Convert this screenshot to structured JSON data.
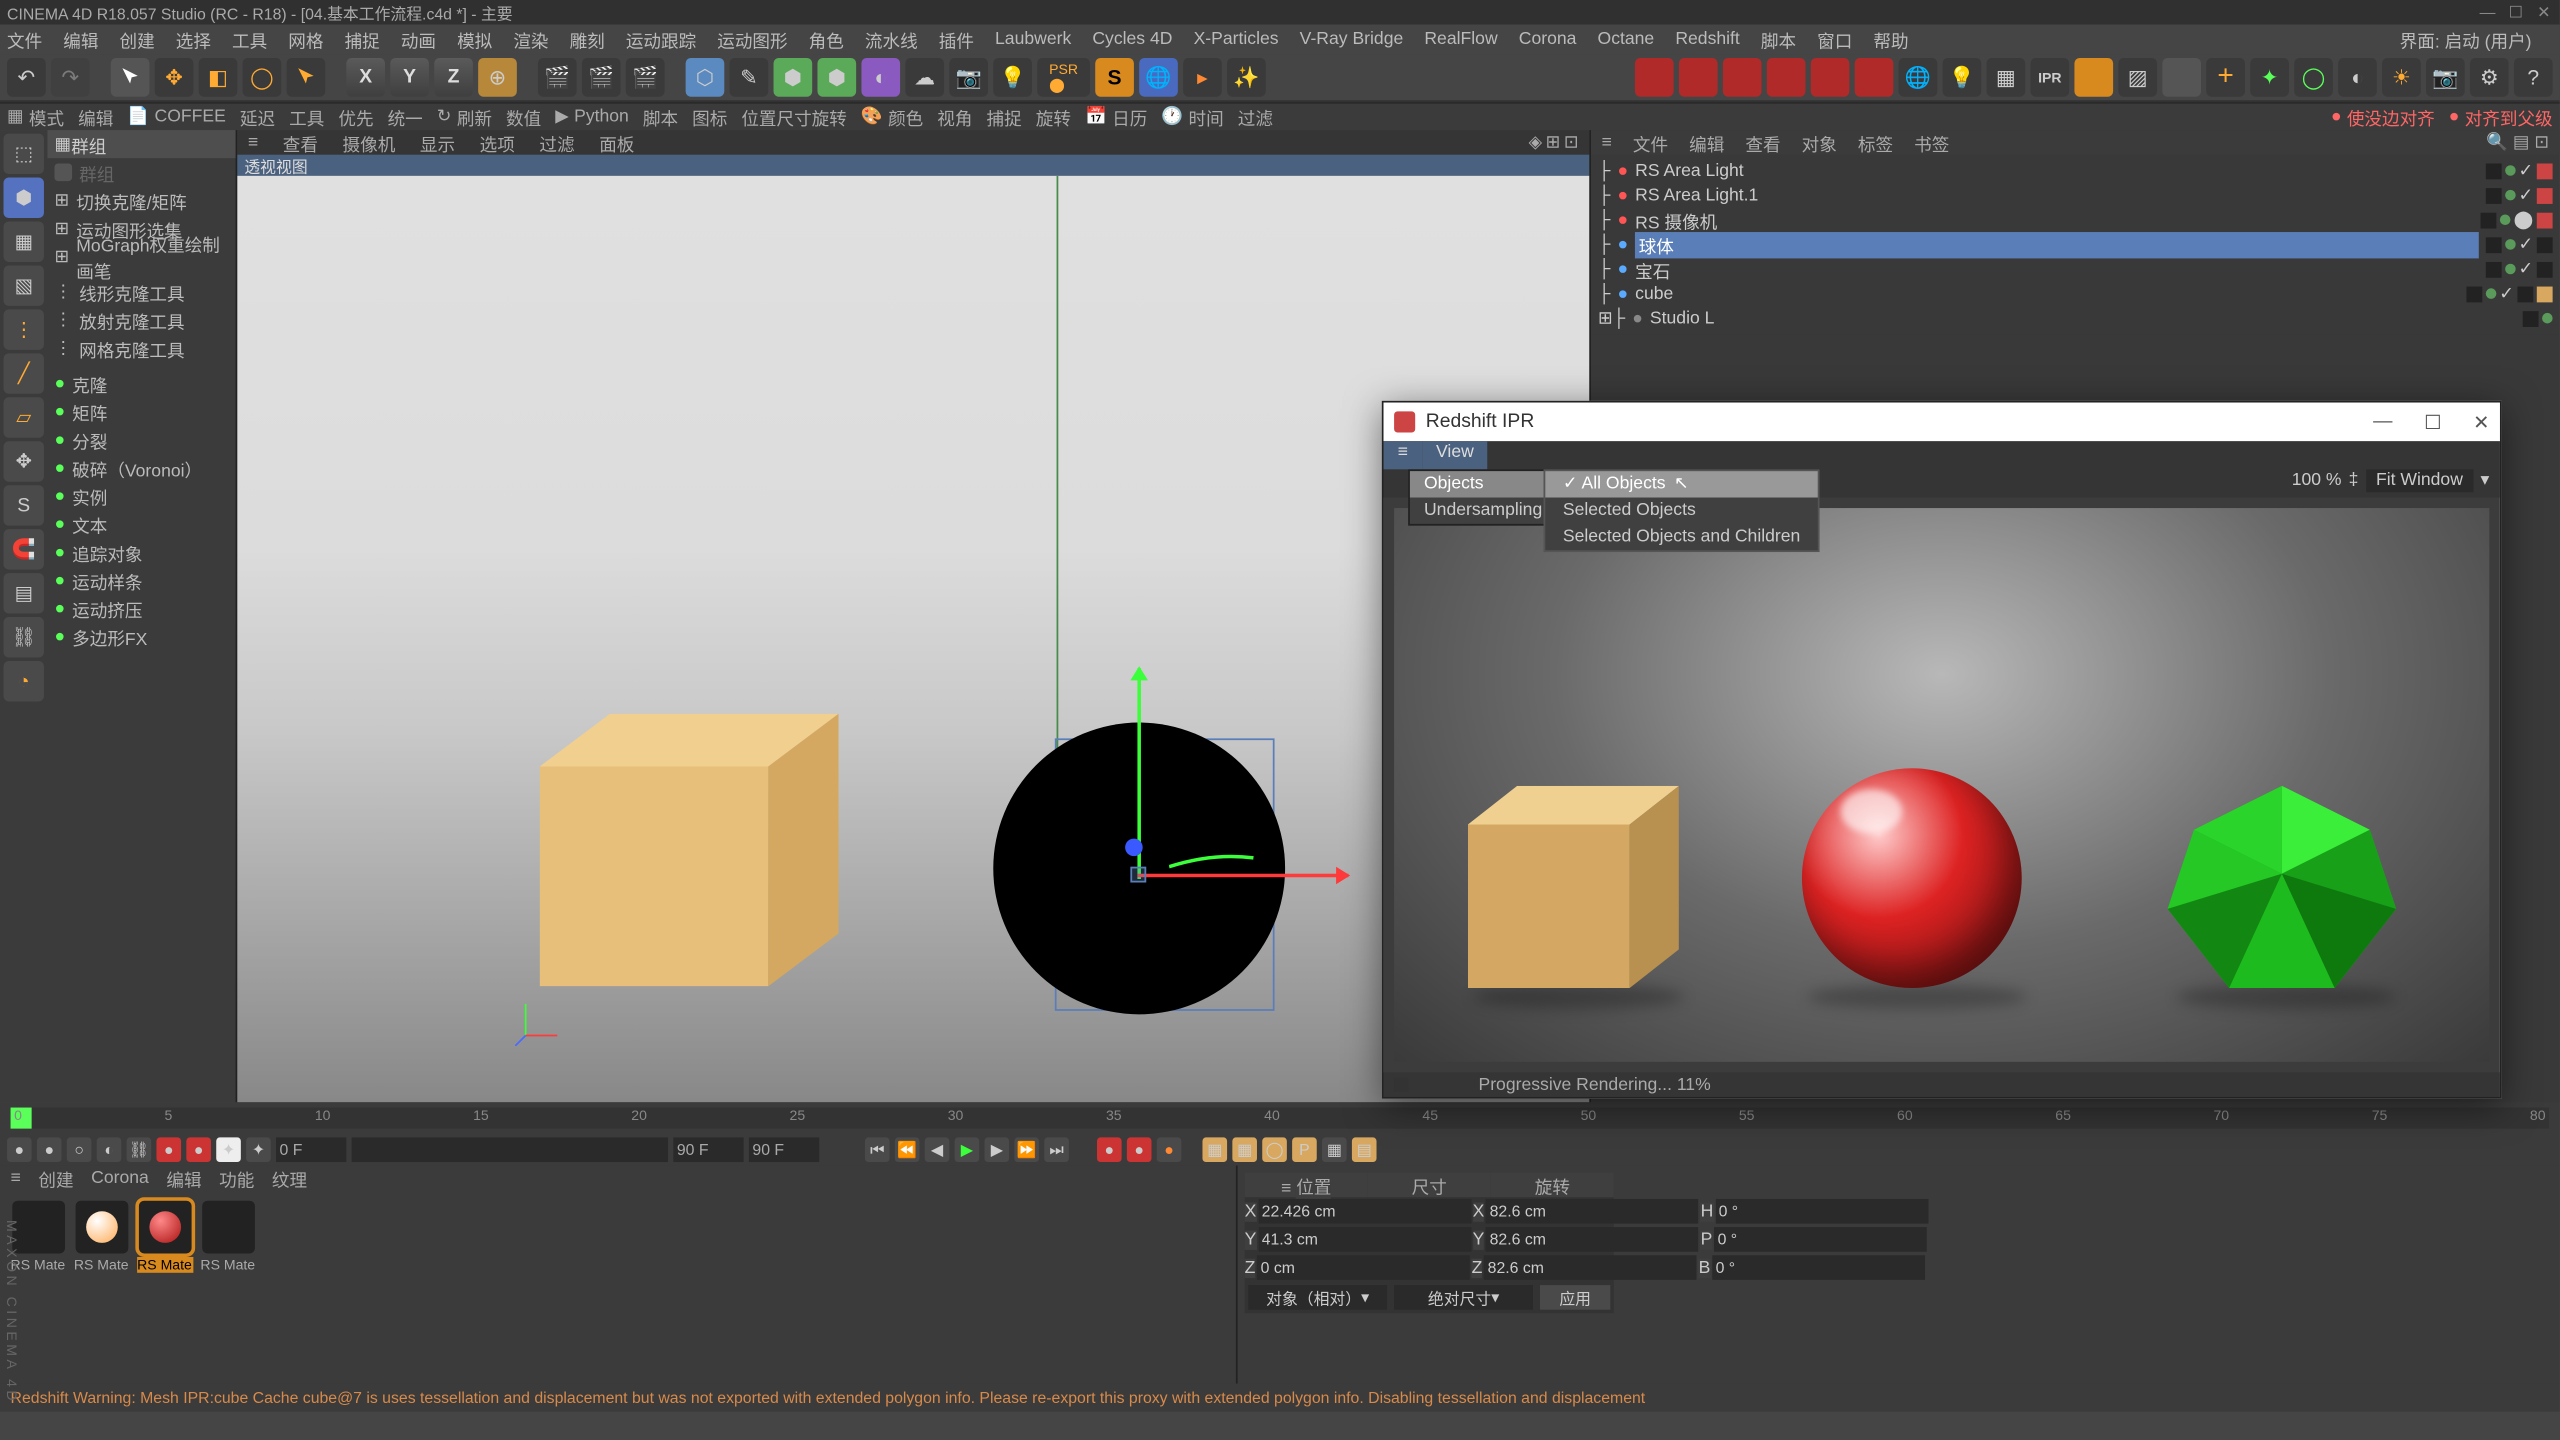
{
  "title": "CINEMA 4D R18.057 Studio (RC - R18) - [04.基本工作流程.c4d *] - 主要",
  "layout_right": "界面: 启动 (用户)",
  "menus": [
    "文件",
    "编辑",
    "创建",
    "选择",
    "工具",
    "网格",
    "捕捉",
    "动画",
    "模拟",
    "渲染",
    "雕刻",
    "运动跟踪",
    "运动图形",
    "角色",
    "流水线",
    "插件",
    "Laubwerk",
    "Cycles 4D",
    "X-Particles",
    "V-Ray Bridge",
    "RealFlow",
    "Corona",
    "Octane",
    "Redshift",
    "脚本",
    "窗口",
    "帮助"
  ],
  "sub_toolbar": {
    "items": [
      "模式",
      "编辑",
      "COFFEE",
      "延迟",
      "工具",
      "优先",
      "统一",
      "刷新",
      "数值",
      "Python",
      "脚本",
      "图标",
      "位置尺寸旋转",
      "颜色",
      "视角",
      "捕捉",
      "旋转",
      "日历",
      "时间",
      "过滤"
    ],
    "right": [
      "使没边对齐",
      "对齐到父级"
    ]
  },
  "left_panel": {
    "head": "群组",
    "items": [
      "群组",
      "切换克隆/矩阵",
      "运动图形选集",
      "MoGraph权重绘制画笔",
      "线形克隆工具",
      "放射克隆工具",
      "网格克隆工具",
      "克隆",
      "矩阵",
      "分裂",
      "破碎（Voronoi）",
      "实例",
      "文本",
      "追踪对象",
      "运动样条",
      "运动挤压",
      "多边形FX"
    ]
  },
  "viewport_menu": [
    "查看",
    "摄像机",
    "显示",
    "选项",
    "过滤",
    "面板"
  ],
  "viewport_label": "透视视图",
  "objects_menu": [
    "文件",
    "编辑",
    "查看",
    "对象",
    "标签",
    "书签"
  ],
  "objects": [
    "RS Area Light",
    "RS Area Light.1",
    "RS 摄像机",
    "球体",
    "宝石",
    "cube",
    "Studio L"
  ],
  "ipr": {
    "title": "Redshift IPR",
    "tab": "View",
    "menu1": "Objects",
    "menu2": "Undersampling",
    "sub1": "All Objects",
    "sub2": "Selected Objects",
    "sub3": "Selected Objects and Children",
    "zoom": "100 %",
    "fit": "Fit Window",
    "status": "Progressive Rendering... 11%"
  },
  "timeline": {
    "start": "0 F",
    "current": "0 F",
    "end": "90 F",
    "end2": "90 F",
    "ticks": [
      "0",
      "5",
      "10",
      "15",
      "20",
      "25",
      "30",
      "35",
      "40",
      "45",
      "50",
      "55",
      "60",
      "65",
      "70",
      "75",
      "80"
    ]
  },
  "material_tabs": [
    "创建",
    "Corona",
    "编辑",
    "功能",
    "纹理"
  ],
  "materials": [
    "RS Mate",
    "RS Mate",
    "RS Mate",
    "RS Mate"
  ],
  "coords": {
    "heads": [
      "位置",
      "尺寸",
      "旋转"
    ],
    "x": {
      "p": "22.426 cm",
      "s": "82.6 cm",
      "r": "0 °"
    },
    "y": {
      "p": "41.3 cm",
      "s": "82.6 cm",
      "r": "0 °"
    },
    "z": {
      "p": "0 cm",
      "s": "82.6 cm",
      "r": "0 °"
    },
    "mode1": "对象（相对）",
    "mode2": "绝对尺寸",
    "apply": "应用"
  },
  "status": "Redshift Warning: Mesh IPR:cube Cache cube@7 is uses tessellation and displacement but was not exported with extended polygon info. Please re-export this proxy with extended polygon info. Disabling tessellation and displacement"
}
